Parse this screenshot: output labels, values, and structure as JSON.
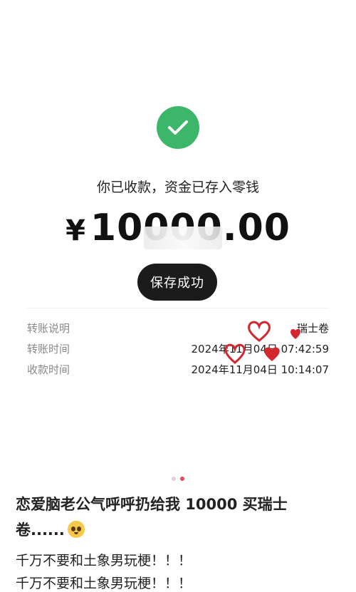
{
  "payment": {
    "status_text": "你已收款，资金已存入零钱",
    "currency": "¥",
    "amount": "10000.00",
    "save_button": "保存成功"
  },
  "details": [
    {
      "label": "转账说明",
      "value": "瑞士卷"
    },
    {
      "label": "转账时间",
      "value": "2024年11月04日 07:42:59"
    },
    {
      "label": "收款时间",
      "value": "2024年11月04日 10:14:07"
    }
  ],
  "carousel": {
    "total": 2,
    "active_index": 1
  },
  "post": {
    "title": "恋爱脑老公气呼呼扔给我 10000 买瑞士卷......",
    "title_emoji": "pleading-face",
    "lines": [
      "千万不要和土象男玩梗！！！",
      "千万不要和土象男玩梗！！！"
    ]
  },
  "colors": {
    "success": "#3cb76a",
    "button": "#1b1b1b",
    "heart": "#d4262f",
    "dot_active": "#e8445a"
  }
}
